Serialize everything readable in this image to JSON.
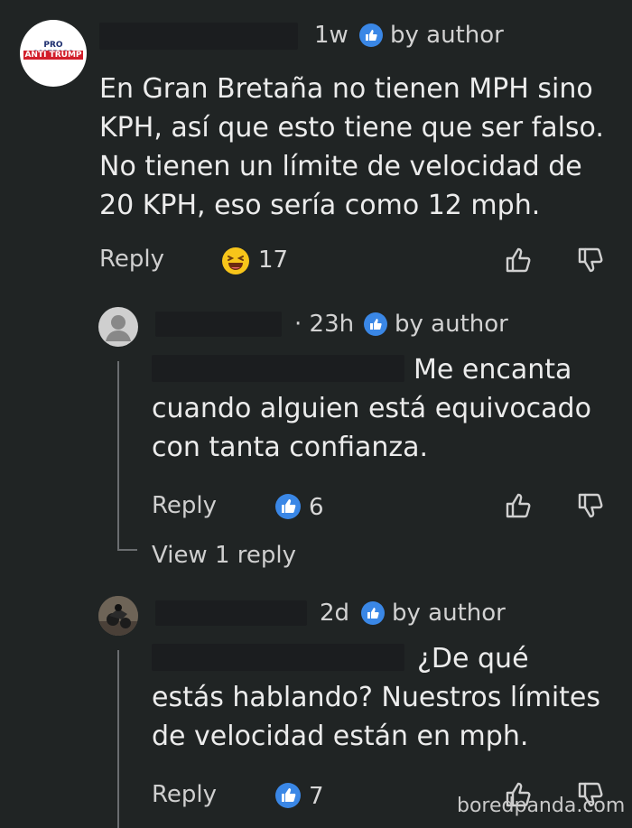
{
  "comments": [
    {
      "avatar_text": [
        "PRO AMERICA",
        "ANTI TRUMP"
      ],
      "time": "1w",
      "badge": "by author",
      "body": "En Gran Bretaña no tienen MPH sino KPH, así que esto tiene que ser falso. No tienen un límite de velocidad de 20 KPH, eso sería como 12 mph.",
      "reply_label": "Reply",
      "reaction_icon": "laughing-emoji-icon",
      "count": "17"
    },
    {
      "time": "· 23h",
      "badge": "by author",
      "body": "Me encanta cuando alguien está equivocado con tanta confianza.",
      "reply_label": "Reply",
      "reaction_icon": "like-icon",
      "count": "6",
      "view_replies": "View 1 reply"
    },
    {
      "time": "2d",
      "badge": "by author",
      "body": "¿De qué estás hablando? Nuestros límites de velocidad están en mph.",
      "reply_label": "Reply",
      "reaction_icon": "like-icon",
      "count": "7"
    }
  ],
  "watermark": "boredpanda.com",
  "colors": {
    "background": "#202424",
    "accent": "#3a87e6",
    "text": "#ececec"
  }
}
